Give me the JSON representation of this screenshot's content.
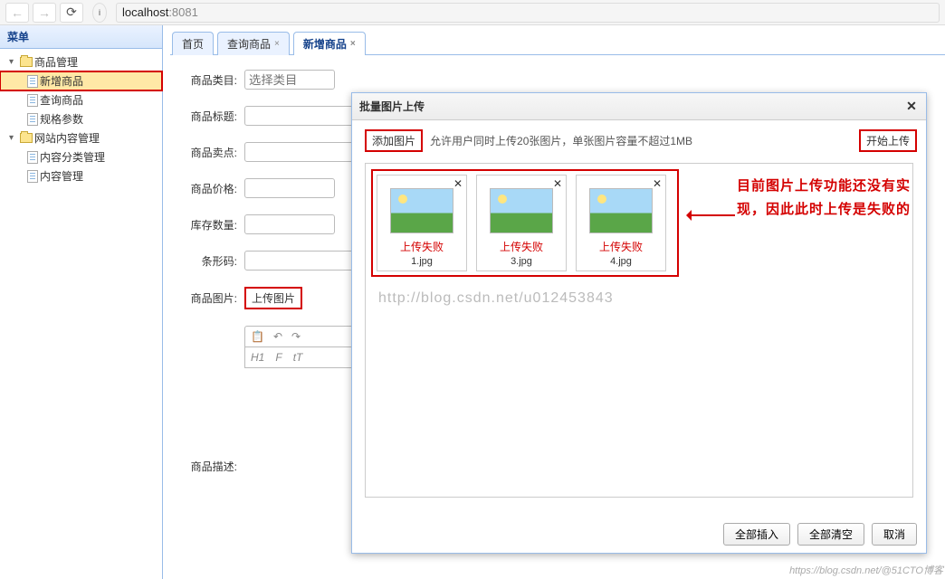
{
  "browser": {
    "url_host": "localhost",
    "url_port": ":8081"
  },
  "sidebar": {
    "title": "菜单",
    "tree": {
      "product_mgmt": "商品管理",
      "add_product": "新增商品",
      "query_product": "查询商品",
      "spec_params": "规格参数",
      "site_content_mgmt": "网站内容管理",
      "content_cat_mgmt": "内容分类管理",
      "content_mgmt": "内容管理"
    }
  },
  "tabs": {
    "home": "首页",
    "query": "查询商品",
    "add": "新增商品",
    "close": "×"
  },
  "form": {
    "category_label": "商品类目:",
    "category_placeholder": "选择类目",
    "title_label": "商品标题:",
    "selling_label": "商品卖点:",
    "price_label": "商品价格:",
    "stock_label": "库存数量:",
    "barcode_label": "条形码:",
    "image_label": "商品图片:",
    "upload_image": "上传图片",
    "desc_label": "商品描述:"
  },
  "editor": {
    "h1": "H1",
    "f": "F",
    "t": "tT"
  },
  "dialog": {
    "title": "批量图片上传",
    "add_image": "添加图片",
    "note": "允许用户同时上传20张图片，单张图片容量不超过1MB",
    "start_upload": "开始上传",
    "thumbs": [
      {
        "status": "上传失败",
        "name": "1.jpg"
      },
      {
        "status": "上传失败",
        "name": "3.jpg"
      },
      {
        "status": "上传失败",
        "name": "4.jpg"
      }
    ],
    "annotation": "目前图片上传功能还没有实现，因此此时上传是失败的",
    "insert_all": "全部插入",
    "clear_all": "全部清空",
    "cancel": "取消",
    "watermark": "http://blog.csdn.net/u012453843"
  },
  "corner": "https://blog.csdn.net/@51CTO博客"
}
